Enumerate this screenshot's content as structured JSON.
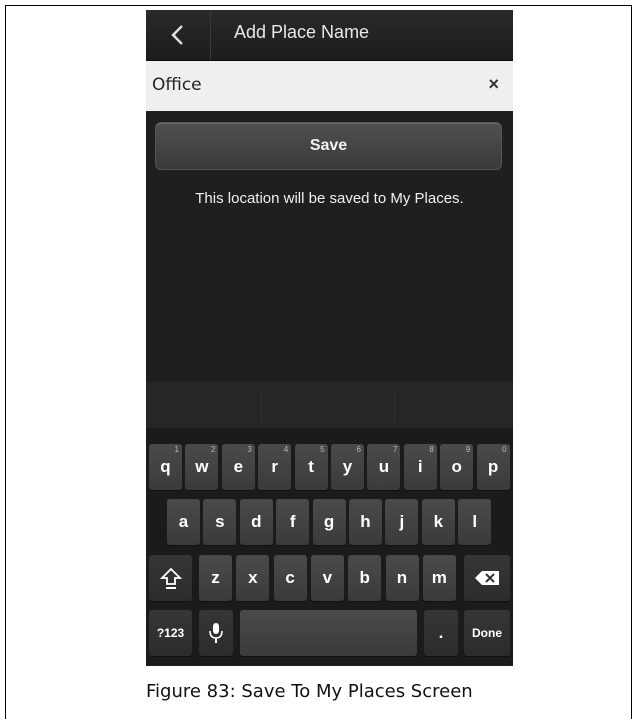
{
  "header": {
    "title": "Add Place Name"
  },
  "input": {
    "value": "Office",
    "clear_symbol": "×"
  },
  "save_label": "Save",
  "info_text": "This location will be saved to My Places.",
  "keyboard": {
    "row1": [
      {
        "label": "q",
        "hint": "1"
      },
      {
        "label": "w",
        "hint": "2"
      },
      {
        "label": "e",
        "hint": "3"
      },
      {
        "label": "r",
        "hint": "4"
      },
      {
        "label": "t",
        "hint": "5"
      },
      {
        "label": "y",
        "hint": "6"
      },
      {
        "label": "u",
        "hint": "7"
      },
      {
        "label": "i",
        "hint": "8"
      },
      {
        "label": "o",
        "hint": "9"
      },
      {
        "label": "p",
        "hint": "0"
      }
    ],
    "row2": [
      "a",
      "s",
      "d",
      "f",
      "g",
      "h",
      "j",
      "k",
      "l"
    ],
    "row3": [
      "z",
      "x",
      "c",
      "v",
      "b",
      "n",
      "m"
    ],
    "symbols_label": "?123",
    "period_label": ".",
    "done_label": "Done"
  },
  "caption": "Figure 83: Save To My Places Screen",
  "colors": {
    "phone_bg": "#1f1f1f",
    "input_bg": "#efefef",
    "key_bg": "#444444"
  }
}
